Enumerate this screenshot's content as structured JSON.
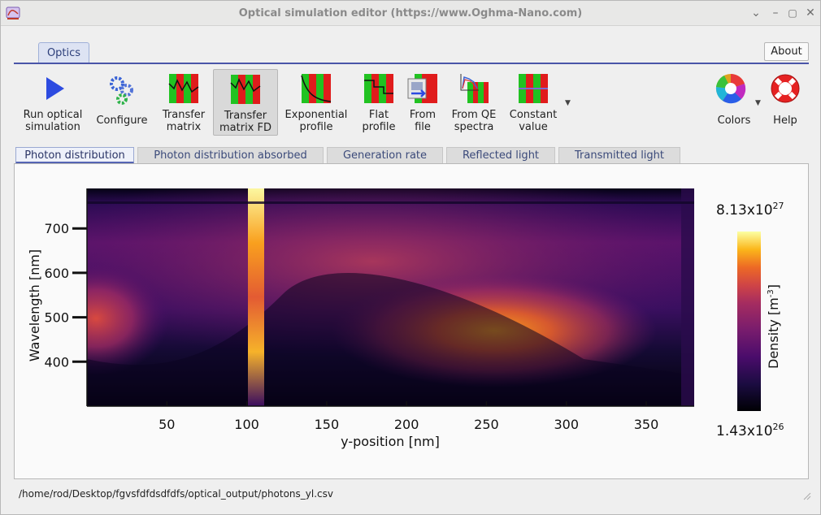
{
  "window": {
    "title": "Optical simulation editor (https://www.Oghma-Nano.com)"
  },
  "top_tabs": [
    {
      "label": "Optics"
    }
  ],
  "about_label": "About",
  "toolbar": {
    "items": [
      {
        "label1": "Run optical",
        "label2": "simulation",
        "icon": "play-icon"
      },
      {
        "label1": "Configure",
        "label2": "",
        "icon": "gears-icon"
      },
      {
        "label1": "Transfer",
        "label2": "matrix",
        "icon": "transfer-matrix-icon"
      },
      {
        "label1": "Transfer",
        "label2": "matrix FD",
        "icon": "transfer-matrix-fd-icon"
      },
      {
        "label1": "Exponential",
        "label2": "profile",
        "icon": "exponential-profile-icon"
      },
      {
        "label1": "Flat",
        "label2": "profile",
        "icon": "flat-profile-icon"
      },
      {
        "label1": "From",
        "label2": "file",
        "icon": "from-file-icon"
      },
      {
        "label1": "From QE",
        "label2": "spectra",
        "icon": "qe-spectra-icon"
      },
      {
        "label1": "Constant",
        "label2": "value",
        "icon": "constant-value-icon"
      }
    ],
    "colors_label": "Colors",
    "help_label": "Help"
  },
  "sub_tabs": [
    {
      "label": "Photon distribution"
    },
    {
      "label": "Photon distribution absorbed"
    },
    {
      "label": "Generation rate"
    },
    {
      "label": "Reflected light"
    },
    {
      "label": "Transmitted light"
    }
  ],
  "chart_data": {
    "type": "heatmap",
    "xlabel": "y-position [nm]",
    "ylabel": "Wavelength [nm]",
    "xlim": [
      0,
      380
    ],
    "ylim": [
      300,
      790
    ],
    "x_ticks": [
      "50",
      "100",
      "150",
      "200",
      "250",
      "300",
      "350"
    ],
    "y_ticks": [
      "400",
      "500",
      "600",
      "700"
    ],
    "colorbar": {
      "label_base": "Density [m",
      "label_exp": "-3",
      "label_end": "]",
      "max_mantissa": "8.13x10",
      "max_exp": "27",
      "min_mantissa": "1.43x10",
      "min_exp": "26",
      "colormap": "inferno"
    }
  },
  "status_path": "/home/rod/Desktop/fgvsfdfdsdfdfs/optical_output/photons_yl.csv"
}
